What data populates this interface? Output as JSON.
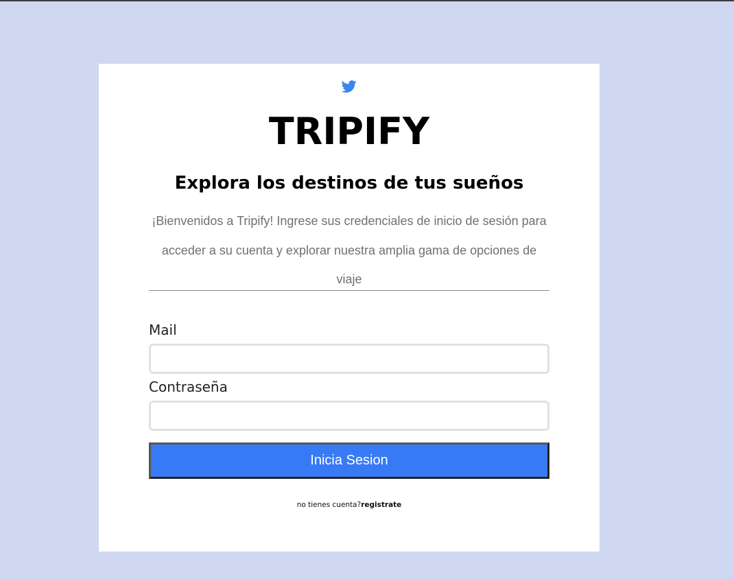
{
  "brand": {
    "name": "TRIPIFY",
    "icon": "twitter-bird-icon",
    "accent_color": "#387af6"
  },
  "hero": {
    "tagline": "Explora los destinos de tus sueños",
    "intro": "¡Bienvenidos a Tripify! Ingrese sus credenciales de inicio de sesión para acceder a su cuenta y explorar nuestra amplia gama de opciones de viaje"
  },
  "form": {
    "mail_label": "Mail",
    "mail_value": "",
    "password_label": "Contraseña",
    "password_value": "",
    "submit_label": "Inicia Sesion"
  },
  "signup": {
    "prompt": "no tienes cuenta?",
    "link_label": "registrate"
  },
  "colors": {
    "page_background": "#d0d7f0",
    "card_background": "#ffffff",
    "button_background": "#387af6"
  }
}
